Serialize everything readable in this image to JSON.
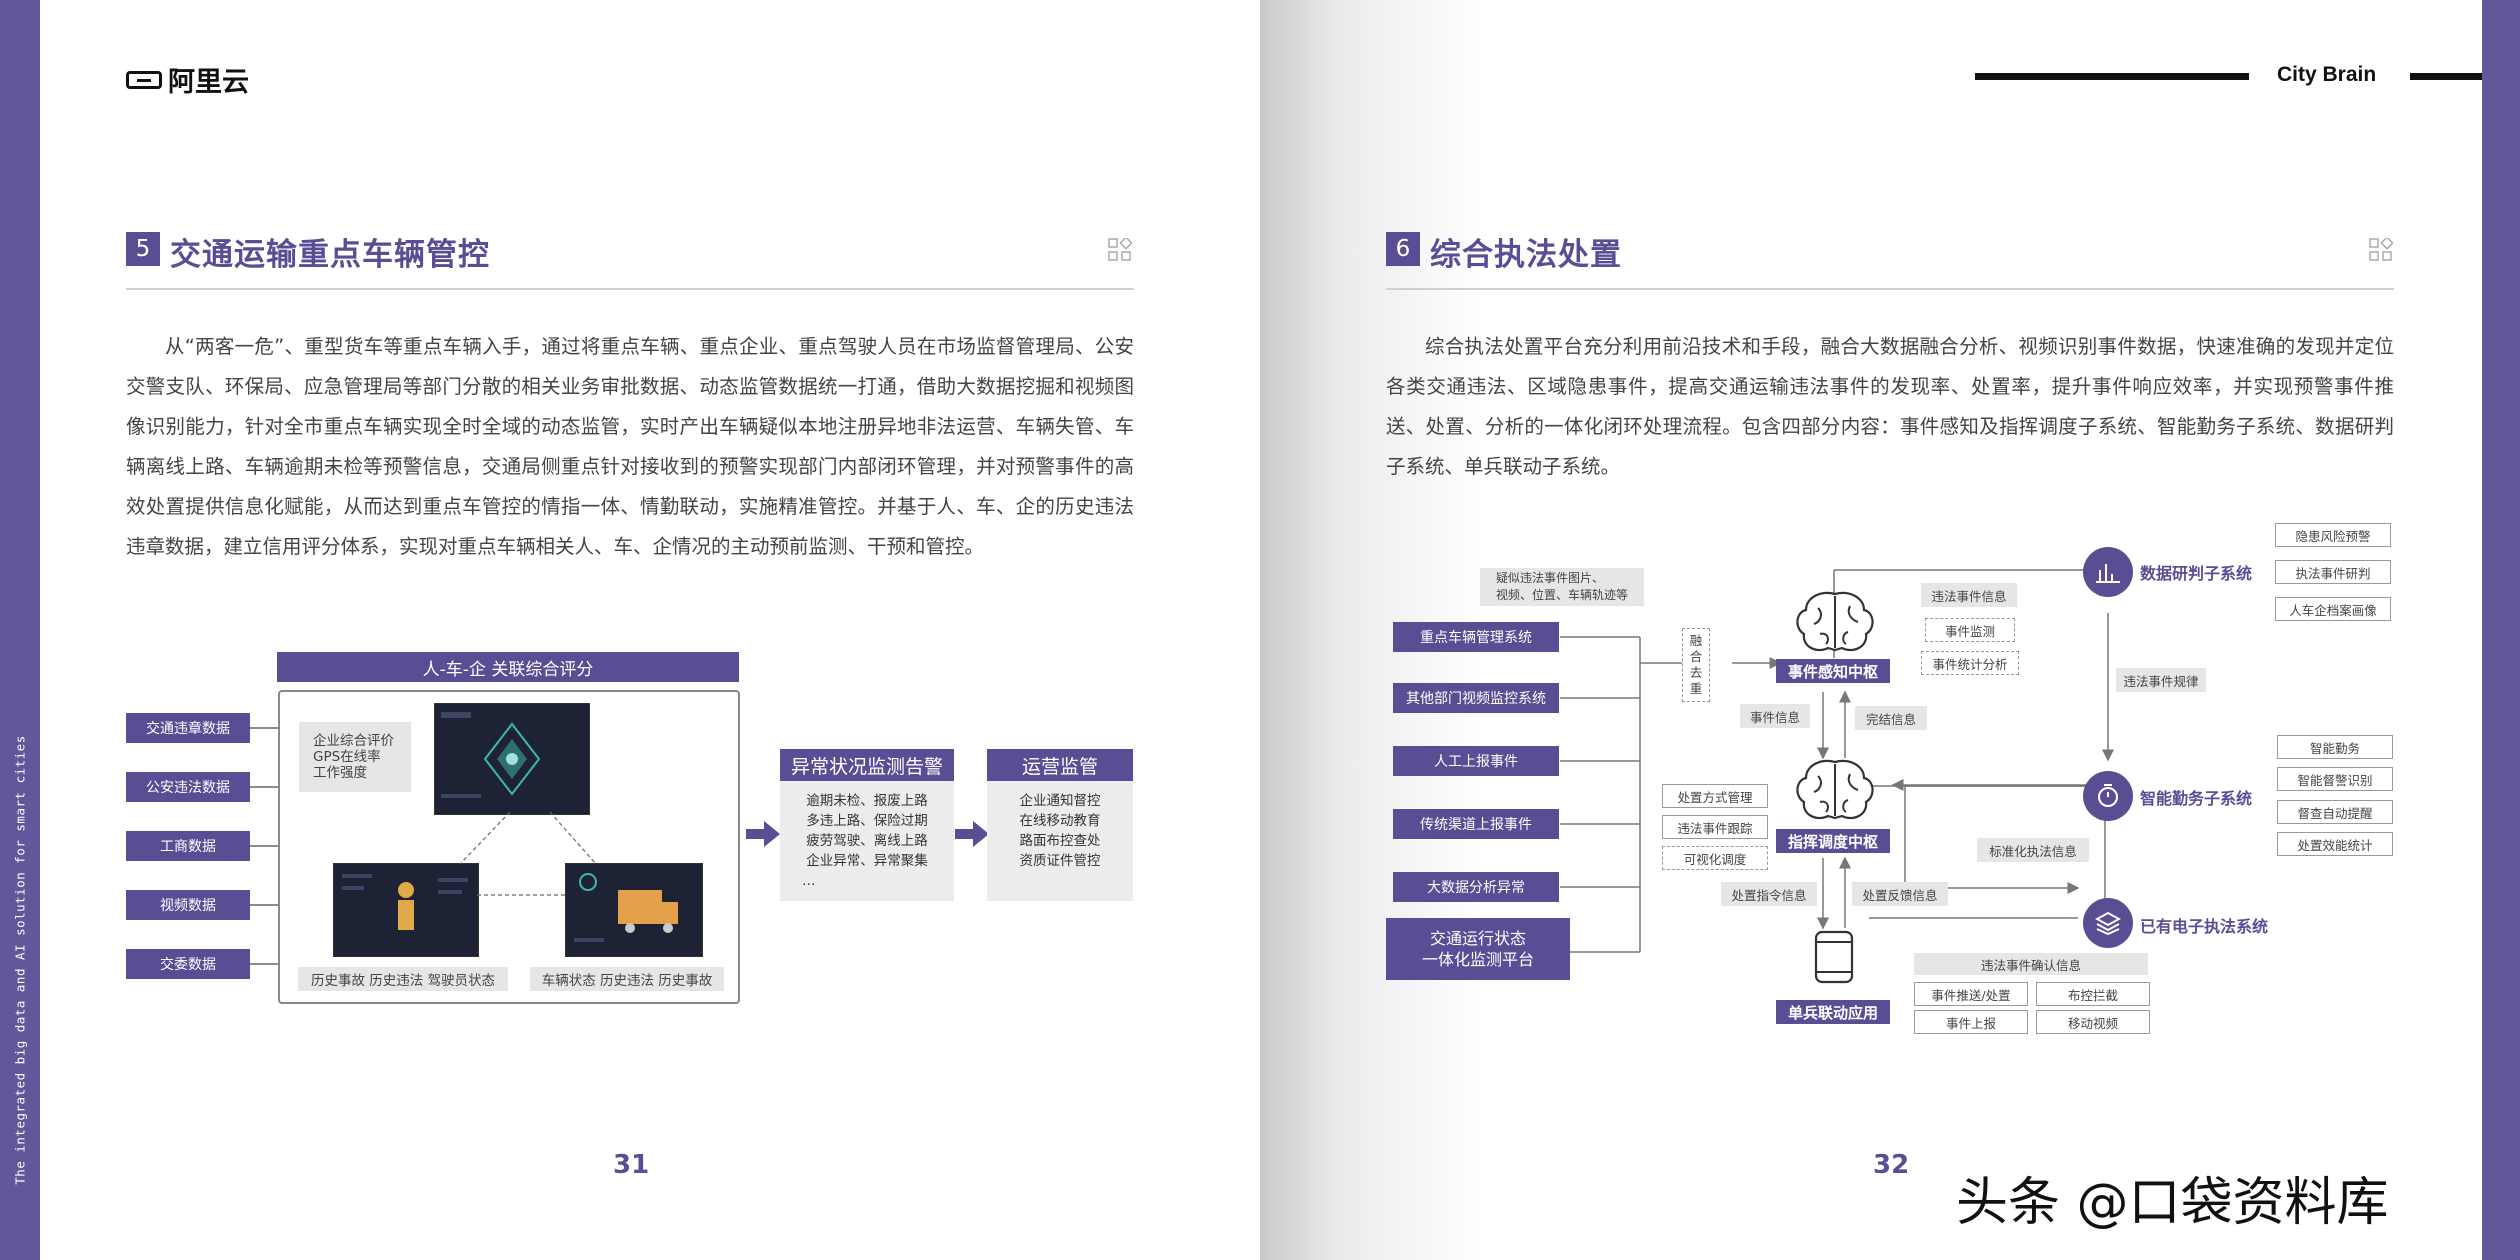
{
  "spine_text": "The integrated big data and AI solution for smart cities",
  "left": {
    "logo_text": "阿里云",
    "section_number": "5",
    "section_title": "交通运输重点车辆管控",
    "body": "从“两客一危”、重型货车等重点车辆入手，通过将重点车辆、重点企业、重点驾驶人员在市场监督管理局、公安交警支队、环保局、应急管理局等部门分散的相关业务审批数据、动态监管数据统一打通，借助大数据挖掘和视频图像识别能力，针对全市重点车辆实现全时全域的动态监管，实时产出车辆疑似本地注册异地非法运营、车辆失管、车辆离线上路、车辆逾期未检等预警信息，交通局侧重点针对接收到的预警实现部门内部闭环管理，并对预警事件的高效处置提供信息化赋能，从而达到重点车管控的情指一体、情勤联动，实施精准管控。并基于人、车、企的历史违法违章数据，建立信用评分体系，实现对重点车辆相关人、车、企情况的主动预前监测、干预和管控。",
    "page_number": "31",
    "diagram": {
      "inputs": [
        "交通违章数据",
        "公安违法数据",
        "工商数据",
        "视频数据",
        "交委数据"
      ],
      "center_title": "人-车-企 关联综合评分",
      "enterprise_note": "企业综合评价\nGPS在线率\n工作强度",
      "person_caption": "历史事故 历史违法 驾驶员状态",
      "vehicle_caption": "车辆状态 历史违法 历史事故",
      "alert_title": "异常状况监测告警",
      "alert_items": [
        "逾期未检、报废上路",
        "多违上路、保险过期",
        "疲劳驾驶、离线上路",
        "企业异常、异常聚集",
        "…"
      ],
      "ops_title": "运营监管",
      "ops_items": [
        "企业通知督控",
        "在线移动教育",
        "路面布控查处",
        "资质证件管控"
      ]
    }
  },
  "right": {
    "brand": "City Brain",
    "section_number": "6",
    "section_title": "综合执法处置",
    "body": "综合执法处置平台充分利用前沿技术和手段，融合大数据融合分析、视频识别事件数据，快速准确的发现并定位各类交通违法、区域隐患事件，提高交通运输违法事件的发现率、处置率，提升事件响应效率，并实现预警事件推送、处置、分析的一体化闭环处理流程。包含四部分内容：事件感知及指挥调度子系统、智能勤务子系统、数据研判子系统、单兵联动子系统。",
    "page_number": "32",
    "diagram": {
      "sources": [
        "重点车辆管理系统",
        "其他部门视频监控系统",
        "人工上报事件",
        "传统渠道上报事件",
        "大数据分析异常"
      ],
      "platform": "交通运行状态\n一体化监测平台",
      "suspect_note": "疑似违法事件图片、\n视频、位置、车辆轨迹等",
      "fusion": "融\n合\n去\n重",
      "hub1": "事件感知中枢",
      "hub2": "指挥调度中枢",
      "single_app": "单兵联动应用",
      "hub1_outputs": [
        "违法事件信息",
        "事件监测",
        "事件统计分析"
      ],
      "event_info": "事件信息",
      "complete_info": "完结信息",
      "hub2_inputs": [
        "处置方式管理",
        "违法事件跟踪",
        "可视化调度"
      ],
      "dispatch_info": "处置指令信息",
      "feedback_info": "处置反馈信息",
      "std_info": "标准化执法信息",
      "violation_rule": "违法事件规律",
      "systems": [
        {
          "name": "数据研判子系统",
          "items": [
            "隐患风险预警",
            "执法事件研判",
            "人车企档案画像"
          ]
        },
        {
          "name": "智能勤务子系统",
          "items": [
            "智能勤务",
            "智能督警识别",
            "督查自动提醒",
            "处置效能统计"
          ]
        },
        {
          "name": "已有电子执法系统",
          "items": []
        }
      ],
      "confirm_title": "违法事件确认信息",
      "confirm_items": [
        "事件推送/处置",
        "布控拦截",
        "事件上报",
        "移动视频"
      ]
    },
    "watermark": "头条 @口袋资料库"
  },
  "colors": {
    "accent": "#5b4d94",
    "band": "#63569a"
  }
}
